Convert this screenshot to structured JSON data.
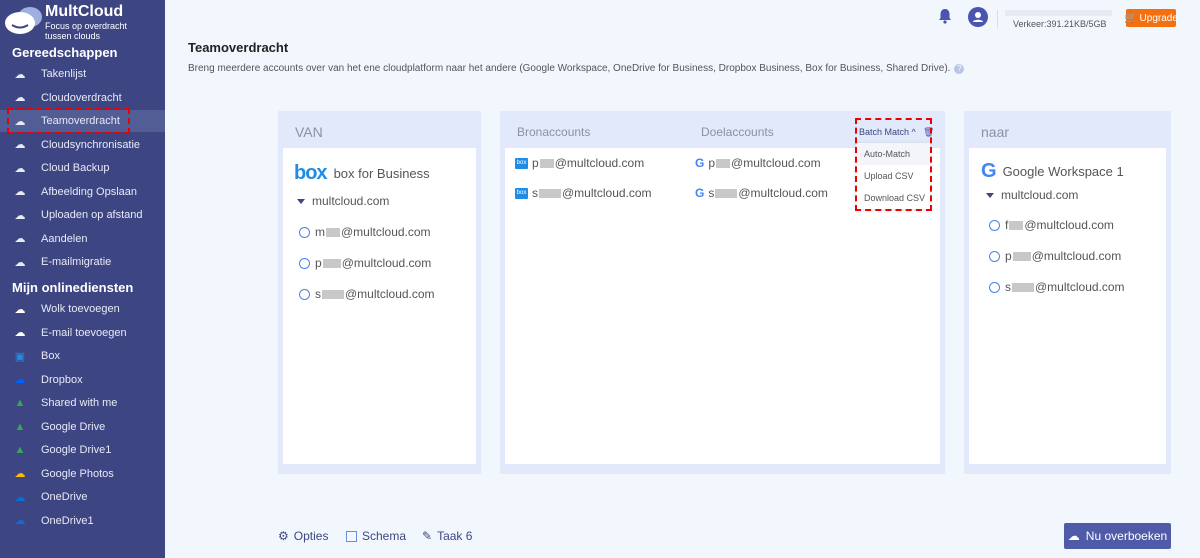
{
  "brand": {
    "name": "MultCloud",
    "tagline": "Focus op overdracht tussen clouds"
  },
  "sidebar": {
    "section1": "Gereedschappen",
    "tools": [
      {
        "label": "Takenlijst",
        "icon": "grid-icon"
      },
      {
        "label": "Cloudoverdracht",
        "icon": "cloud-transfer-icon"
      },
      {
        "label": "Teamoverdracht",
        "icon": "team-transfer-icon"
      },
      {
        "label": "Cloudsynchronisatie",
        "icon": "cloud-sync-icon"
      },
      {
        "label": "Cloud Backup",
        "icon": "cloud-backup-icon"
      },
      {
        "label": "Afbeelding Opslaan",
        "icon": "image-save-icon"
      },
      {
        "label": "Uploaden op afstand",
        "icon": "remote-upload-icon"
      },
      {
        "label": "Aandelen",
        "icon": "share-icon"
      },
      {
        "label": "E-mailmigratie",
        "icon": "email-migration-icon"
      }
    ],
    "section2": "Mijn onlinediensten",
    "services": [
      {
        "label": "Wolk toevoegen",
        "icon": "add-cloud-icon"
      },
      {
        "label": "E-mail toevoegen",
        "icon": "add-email-icon"
      },
      {
        "label": "Box",
        "icon": "box-icon"
      },
      {
        "label": "Dropbox",
        "icon": "dropbox-icon"
      },
      {
        "label": "Shared with me",
        "icon": "google-drive-icon"
      },
      {
        "label": "Google Drive",
        "icon": "google-drive-icon"
      },
      {
        "label": "Google Drive1",
        "icon": "google-drive-icon"
      },
      {
        "label": "Google Photos",
        "icon": "google-photos-icon"
      },
      {
        "label": "OneDrive",
        "icon": "onedrive-icon"
      },
      {
        "label": "OneDrive1",
        "icon": "onedrive-icon"
      }
    ]
  },
  "topbar": {
    "traffic": "Verkeer:391.21KB/5GB",
    "upgrade": "Upgrade"
  },
  "page": {
    "title": "Teamoverdracht",
    "description": "Breng meerdere accounts over van het ene cloudplatform naar het andere (Google Workspace, OneDrive for Business, Dropbox Business, Box for Business, Shared Drive)."
  },
  "from": {
    "header": "VAN",
    "service": "box for Business",
    "domain": "multcloud.com",
    "accounts": [
      {
        "first": "m",
        "rest": "@multcloud.com"
      },
      {
        "first": "p",
        "rest": "@multcloud.com"
      },
      {
        "first": "s",
        "rest": "@multcloud.com"
      }
    ]
  },
  "match": {
    "source_header": "Bronaccounts",
    "target_header": "Doelaccounts",
    "batch": "Batch Match",
    "menu": [
      "Auto-Match",
      "Upload CSV",
      "Download CSV"
    ],
    "pairs": [
      {
        "src_first": "p",
        "src_rest": "@multcloud.com",
        "dst_first": "p",
        "dst_rest": "@multcloud.com"
      },
      {
        "src_first": "s",
        "src_rest": "@multcloud.com",
        "dst_first": "s",
        "dst_rest": "@multcloud.com"
      }
    ]
  },
  "to": {
    "header": "naar",
    "service": "Google Workspace 1",
    "domain": "multcloud.com",
    "accounts": [
      {
        "first": "f",
        "rest": "@multcloud.com"
      },
      {
        "first": "p",
        "rest": "@multcloud.com"
      },
      {
        "first": "s",
        "rest": "@multcloud.com"
      }
    ]
  },
  "footer": {
    "options": "Opties",
    "schedule": "Schema",
    "task": "Taak 6",
    "submit": "Nu overboeken"
  },
  "colors": {
    "sidebar": "#3d4683",
    "accent": "#4f5aa8",
    "upgrade": "#f66f0f",
    "highlight": "#e00000"
  }
}
